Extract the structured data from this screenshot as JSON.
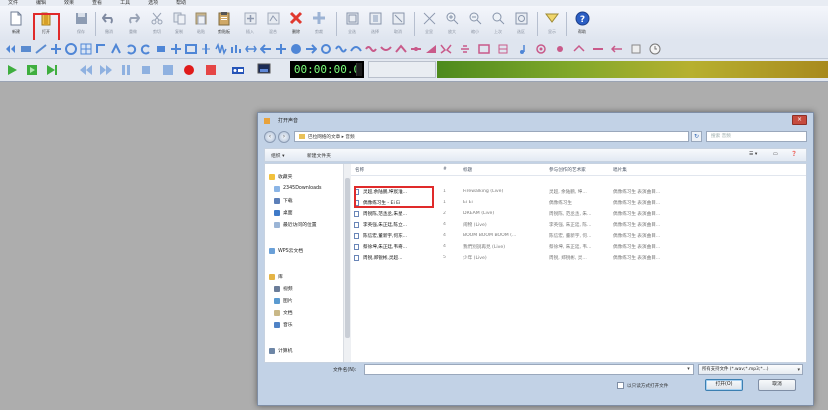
{
  "menubar": {
    "items": [
      "文件",
      "编辑",
      "效果",
      "查看",
      "工具",
      "选项",
      "帮助"
    ]
  },
  "toolbar1": {
    "buttons": [
      {
        "name": "new-button",
        "icon": "new-document-icon",
        "label": "新建"
      },
      {
        "name": "open-button",
        "icon": "open-folder-icon",
        "label": "打开"
      },
      {
        "name": "save-button",
        "icon": "save-icon",
        "label": "保存"
      },
      {
        "name": "undo-button",
        "icon": "undo-icon",
        "label": "撤消"
      },
      {
        "name": "redo-button",
        "icon": "redo-icon",
        "label": "重做"
      },
      {
        "name": "cut-button",
        "icon": "cut-icon",
        "label": "剪切"
      },
      {
        "name": "copy-button",
        "icon": "copy-icon",
        "label": "复制"
      },
      {
        "name": "paste-button",
        "icon": "paste-icon",
        "label": "粘贴"
      },
      {
        "name": "clipboard-button",
        "icon": "clipboard-icon",
        "label": "剪贴板"
      },
      {
        "name": "insert-button",
        "icon": "plus-icon",
        "label": "插入"
      },
      {
        "name": "mix-button",
        "icon": "mix-icon",
        "label": "混合"
      },
      {
        "name": "delete-button",
        "icon": "red-x-icon",
        "label": "删除"
      },
      {
        "name": "crop-button",
        "icon": "crop-icon",
        "label": "剪裁"
      },
      {
        "name": "selectall-button",
        "icon": "select-all-icon",
        "label": "全选"
      },
      {
        "name": "select-button",
        "icon": "select-icon",
        "label": "选择"
      },
      {
        "name": "deselect-button",
        "icon": "deselect-icon",
        "label": "取消"
      },
      {
        "name": "fit-button",
        "icon": "fit-icon",
        "label": "全显"
      },
      {
        "name": "zoomin-button",
        "icon": "zoom-in-icon",
        "label": "放大"
      },
      {
        "name": "zoomout-button",
        "icon": "zoom-out-icon",
        "label": "缩小"
      },
      {
        "name": "zoomsel-button",
        "icon": "zoom-selection-icon",
        "label": "上次"
      },
      {
        "name": "zoomfull-button",
        "icon": "zoom-full-icon",
        "label": "选区"
      },
      {
        "name": "marker-button",
        "icon": "marker-icon",
        "label": "显示"
      },
      {
        "name": "help-button",
        "icon": "help-icon",
        "label": "帮助"
      }
    ]
  },
  "transport": {
    "time": "00:00:00.0"
  },
  "dialog": {
    "title": "打开声音",
    "address": "巴拉网络的文章 ▸ 音频",
    "search_placeholder": "搜索 音频",
    "organize": "组织 ▾",
    "new_folder": "新建文件夹",
    "nav": [
      {
        "icon": "star-icon",
        "label": "收藏夹",
        "color": "#f2c13c"
      },
      {
        "icon": "folder-icon",
        "label": "2345Downloads",
        "color": "#8bb5e6"
      },
      {
        "icon": "folder-icon",
        "label": "下载",
        "color": "#5c7fb8"
      },
      {
        "icon": "desktop-icon",
        "label": "桌面",
        "color": "#3f7ac8"
      },
      {
        "icon": "folder-icon",
        "label": "最近访问的位置",
        "color": "#9bb5d6"
      },
      {
        "icon": "cloud-icon",
        "label": "WPS云文档",
        "color": "#6aa0d8"
      },
      {
        "icon": "library-icon",
        "label": "库",
        "color": "#e5b445"
      },
      {
        "icon": "video-icon",
        "label": "视频",
        "color": "#6b7d99"
      },
      {
        "icon": "picture-icon",
        "label": "图片",
        "color": "#5a9ad0"
      },
      {
        "icon": "document-icon",
        "label": "文档",
        "color": "#c9b887"
      },
      {
        "icon": "music-icon",
        "label": "音乐",
        "color": "#4f83c6"
      },
      {
        "icon": "computer-icon",
        "label": "计算机",
        "color": "#6d86a6"
      }
    ],
    "columns": [
      "名称",
      "#",
      "标题",
      "参与创作的艺术家",
      "唱片集"
    ],
    "files": [
      {
        "name": "灵超,余陆鹏,坤宸淮...",
        "num": "1",
        "title": "Firewalking (Live)",
        "artist": "灵超, 余陆鹏, 坤...",
        "album": "偶像练习生 表演曲目..."
      },
      {
        "name": "偶像练习生 - Ei Ei",
        "num": "1",
        "title": "Ei Ei",
        "artist": "偶像练习生",
        "album": "偶像练习生 表演曲目..."
      },
      {
        "name": "周锐陈,范丞丞,朱星...",
        "num": "2",
        "title": "DREAM (Live)",
        "artist": "周锐陈, 范丞丞, 朱...",
        "album": "偶像练习生 表演曲目..."
      },
      {
        "name": "李英强,朱正廷,陈立...",
        "num": "4",
        "title": "闹物 (Live)",
        "artist": "李英强, 朱正廷, 陈...",
        "album": "偶像练习生 表演曲目..."
      },
      {
        "name": "陈信宏,董新宇,何东...",
        "num": "4",
        "title": "BOOM BOOM BOOM (...",
        "artist": "陈信宏, 董新宇, 何...",
        "album": "偶像练习生 表演曲目..."
      },
      {
        "name": "蔡徐坤,朱正廷,韦奇...",
        "num": "4",
        "title": "我們別說再見 (Live)",
        "artist": "蔡徐坤, 朱正廷, 韦...",
        "album": "偶像练习生 表演曲目..."
      },
      {
        "name": "周锐,郑锐彬,灵超...",
        "num": "5",
        "title": "少年 (Live)",
        "artist": "周锐, 郑锐彬, 灵...",
        "album": "偶像练习生 表演曲目..."
      }
    ],
    "filename_label": "文件名(N):",
    "filename_value": "",
    "filetype": "所有支持文件 (*.wav;*.mp3;*...)",
    "readonly_label": "以只读方式打开文件",
    "open_label": "打开(O)",
    "cancel_label": "取消"
  }
}
